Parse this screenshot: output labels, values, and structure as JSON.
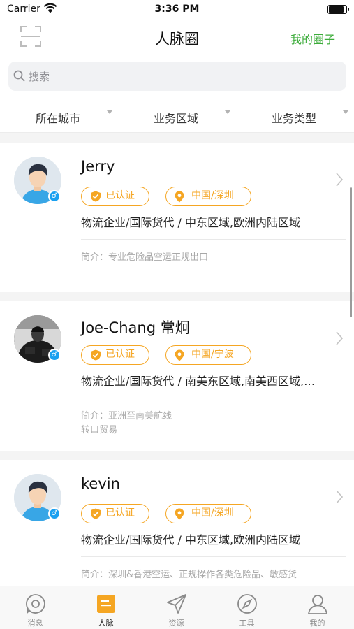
{
  "status_bar": {
    "carrier": "Carrier",
    "time": "3:36 PM"
  },
  "nav": {
    "title": "人脉圈",
    "right_action": "我的圈子"
  },
  "search": {
    "placeholder": "搜索"
  },
  "filters": [
    {
      "label": "所在城市"
    },
    {
      "label": "业务区域"
    },
    {
      "label": "业务类型"
    }
  ],
  "cards": [
    {
      "name": "Jerry",
      "verified": "已认证",
      "location": "中国/深圳",
      "business": "物流企业/国际货代 / 中东区域,欧洲内陆区域",
      "intro": [
        "简介：专业危险品空运正规出口"
      ],
      "gender": "♂"
    },
    {
      "name": "Joe-Chang 常炯",
      "verified": "已认证",
      "location": "中国/宁波",
      "business": "物流企业/国际货代 / 南美东区域,南美西区域,…",
      "intro": [
        "简介：亚洲至南美航线",
        "转口贸易"
      ],
      "gender": "♂"
    },
    {
      "name": "kevin",
      "verified": "已认证",
      "location": "中国/深圳",
      "business": "物流企业/国际货代 / 中东区域,欧洲内陆区域",
      "intro": [
        "简介：深圳&香港空运、正规操作各类危险品、敏感货"
      ],
      "gender": "♂"
    }
  ],
  "tabs": [
    {
      "label": "消息",
      "icon": "message-icon"
    },
    {
      "label": "人脉",
      "icon": "contacts-icon",
      "active": true
    },
    {
      "label": "资源",
      "icon": "send-icon"
    },
    {
      "label": "工具",
      "icon": "compass-icon"
    },
    {
      "label": "我的",
      "icon": "profile-icon"
    }
  ],
  "colors": {
    "accent_green": "#3cac3a",
    "tag_orange": "#f5a623",
    "active_tab": "#f5a623",
    "gender_blue": "#1aa0f0"
  }
}
